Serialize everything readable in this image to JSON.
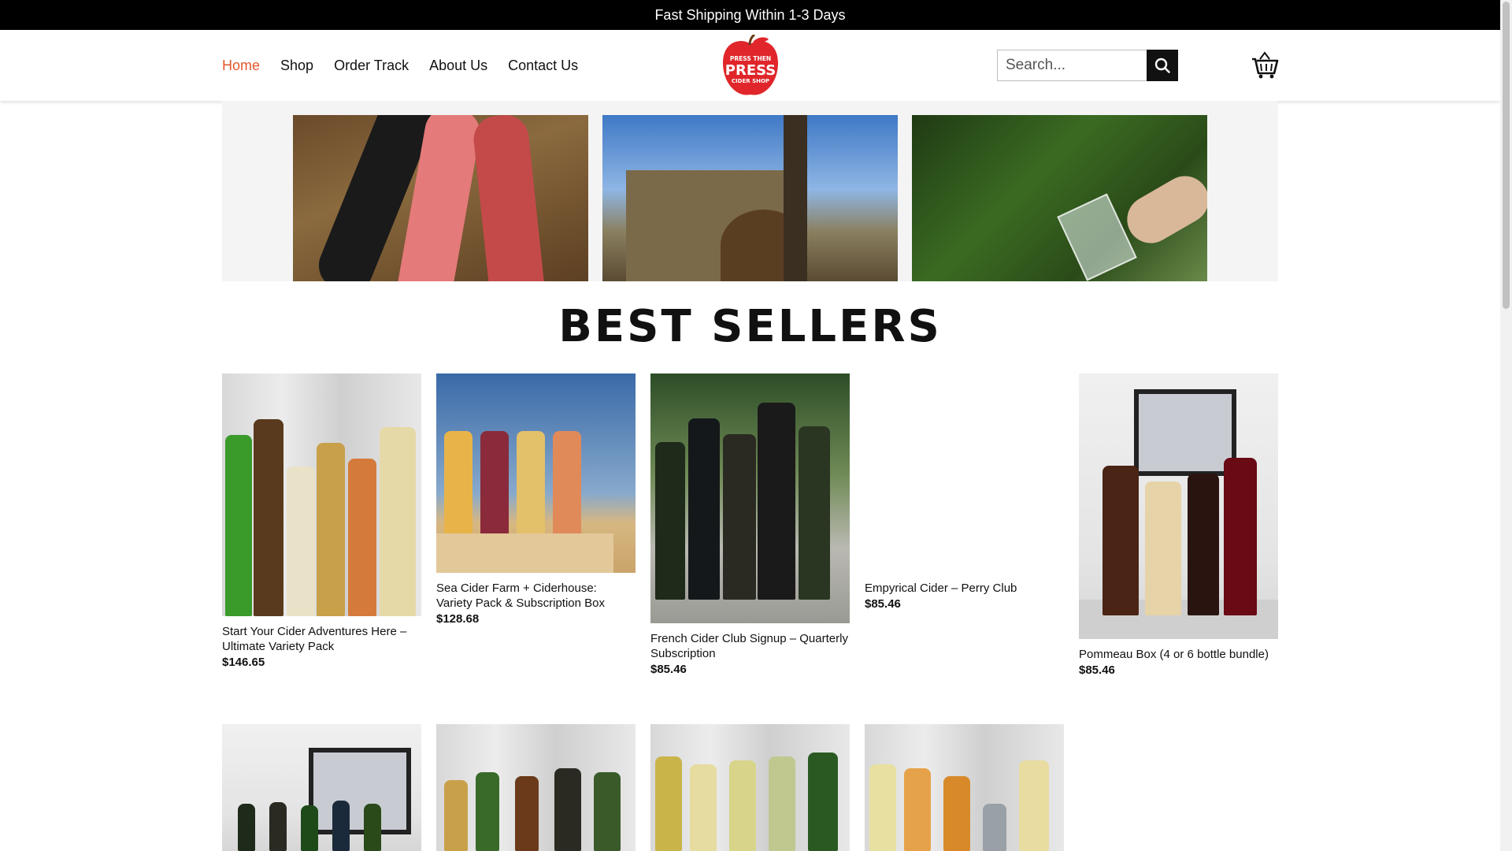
{
  "topbar": {
    "text": "Fast Shipping Within 1-3 Days"
  },
  "nav": {
    "items": [
      {
        "label": "Home",
        "active": true
      },
      {
        "label": "Shop",
        "active": false
      },
      {
        "label": "Order Track",
        "active": false
      },
      {
        "label": "About Us",
        "active": false
      },
      {
        "label": "Contact Us",
        "active": false
      }
    ]
  },
  "logo": {
    "line1": "PRESS THEN",
    "line2": "PRESS",
    "line3": "CIDER SHOP"
  },
  "search": {
    "placeholder": "Search...",
    "value": ""
  },
  "colors": {
    "accent": "#e4572e",
    "topbar": "#000000",
    "logo_red": "#e0262a"
  },
  "icons": {
    "search": "search-icon",
    "cart": "cart-icon"
  },
  "section": {
    "title": "BEST SELLERS"
  },
  "products": [
    {
      "name": "Start Your Cider Adventures Here – Ultimate Variety Pack",
      "price": "$146.65"
    },
    {
      "name": "Sea Cider Farm + Ciderhouse: Variety Pack & Subscription Box",
      "price": "$128.68"
    },
    {
      "name": "French Cider Club Signup – Quarterly Subscription",
      "price": "$85.46"
    },
    {
      "name": "Empyrical Cider – Perry Club",
      "price": "$85.46"
    },
    {
      "name": "Pommeau Box (4 or 6 bottle bundle)",
      "price": "$85.46"
    }
  ]
}
